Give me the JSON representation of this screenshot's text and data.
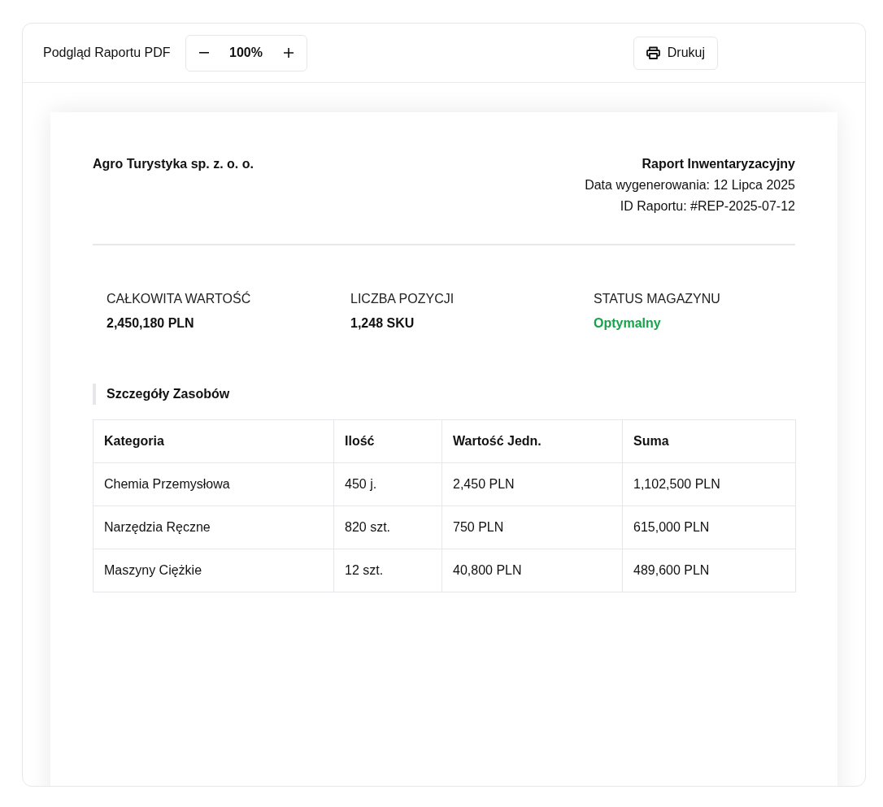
{
  "toolbar": {
    "title": "Podgląd Raportu PDF",
    "zoom": {
      "value": "100%"
    },
    "print_button": {
      "label": "Drukuj"
    }
  },
  "report": {
    "company": "Agro Turystyka sp. z. o. o.",
    "title": "Raport Inwentaryzacyjny",
    "meta": [
      "Data wygenerowania: 12 Lipca 2025",
      "ID Raportu: #REP-2025-07-12"
    ],
    "summary": [
      {
        "label": "CAŁKOWITA WARTOŚĆ",
        "value": "2,450,180 PLN",
        "kind": "amount"
      },
      {
        "label": "LICZBA POZYCJI",
        "value": "1,248 SKU",
        "kind": "amount"
      },
      {
        "label": "STATUS MAGAZYNU",
        "value": "Optymalny",
        "kind": "status"
      }
    ],
    "section_title": "Szczegóły Zasobów",
    "table": {
      "columns": [
        "Kategoria",
        "Ilość",
        "Wartość Jedn.",
        "Suma"
      ],
      "rows": [
        [
          "Chemia Przemysłowa",
          "450 j.",
          "2,450 PLN",
          "1,102,500 PLN"
        ],
        [
          "Narzędzia Ręczne",
          "820 szt.",
          "750 PLN",
          "615,000 PLN"
        ],
        [
          "Maszyny Ciężkie",
          "12 szt.",
          "40,800 PLN",
          "489,600 PLN"
        ]
      ]
    }
  }
}
